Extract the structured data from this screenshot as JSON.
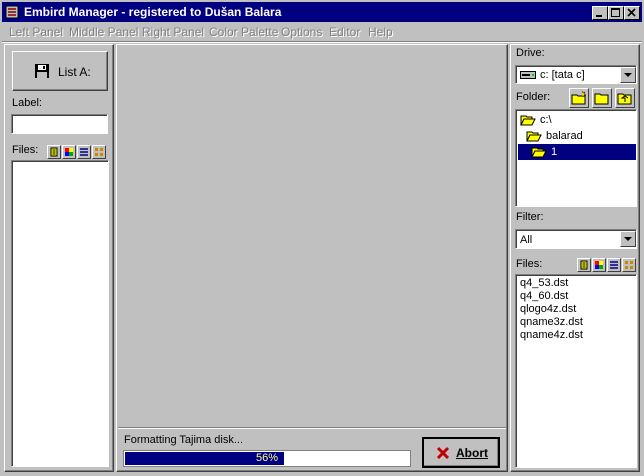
{
  "window": {
    "title": "Embird Manager - registered to Dušan Balara"
  },
  "menu": [
    "Left Panel",
    "Middle Panel",
    "Right Panel",
    "Color Palette",
    "Options",
    "Editor",
    "Help"
  ],
  "left": {
    "list_button": "List A:",
    "label_caption": "Label:",
    "label_value": "",
    "files_caption": "Files:"
  },
  "middle": {
    "status_text": "Formatting Tajima disk...",
    "progress_percent": 56,
    "progress_label": "56%",
    "abort_label": "Abort"
  },
  "right": {
    "drive_caption": "Drive:",
    "drive_value": "c: [tata c]",
    "folder_caption": "Folder:",
    "folders": [
      {
        "name": "c:\\",
        "selected": false
      },
      {
        "name": "balarad",
        "selected": false
      },
      {
        "name": "1",
        "selected": true
      }
    ],
    "filter_caption": "Filter:",
    "filter_value": "All",
    "files_caption": "Files:",
    "files": [
      "q4_53.dst",
      "q4_60.dst",
      "qlogo4z.dst",
      "qname3z.dst",
      "qname4z.dst"
    ]
  },
  "colors": {
    "titlebar": "#000080",
    "face": "#c0c0c0",
    "selection": "#000080",
    "abort_x": "#c00000"
  }
}
